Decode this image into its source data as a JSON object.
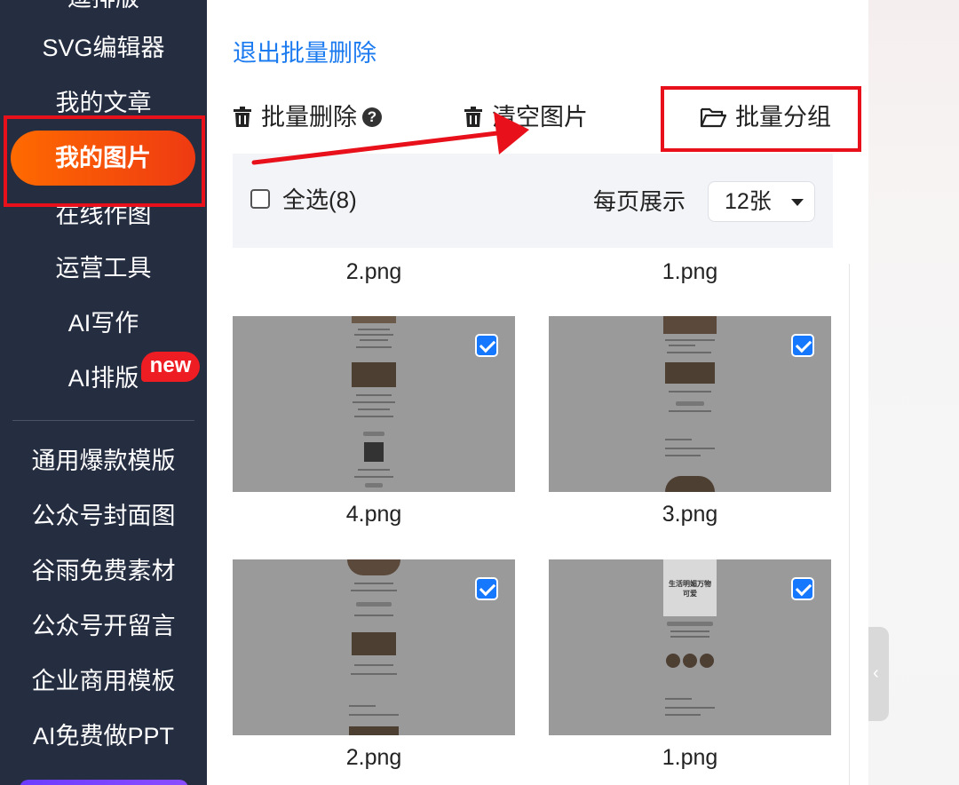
{
  "sidebar": {
    "top_partial": "逗排版",
    "items": [
      {
        "label": "SVG编辑器"
      },
      {
        "label": "我的文章"
      },
      {
        "label": "我的图片",
        "active": true
      },
      {
        "label": "在线作图"
      },
      {
        "label": "运营工具"
      },
      {
        "label": "AI写作"
      },
      {
        "label": "AI排版",
        "badge": "new"
      }
    ],
    "items2": [
      {
        "label": "通用爆款模版"
      },
      {
        "label": "公众号封面图"
      },
      {
        "label": "谷雨免费素材"
      },
      {
        "label": "公众号开留言"
      },
      {
        "label": "企业商用模板"
      },
      {
        "label": "AI免费做PPT"
      }
    ]
  },
  "main": {
    "exit_batch_delete": "退出批量删除",
    "toolbar": {
      "batch_delete": "批量删除",
      "help_glyph": "?",
      "clear_images": "清空图片",
      "batch_group": "批量分组"
    },
    "filter": {
      "select_all": "全选(8)",
      "per_page_label": "每页展示",
      "per_page_value": "12张"
    },
    "images": [
      {
        "name": "2.png",
        "checked": true
      },
      {
        "name": "1.png",
        "checked": true
      },
      {
        "name": "4.png",
        "checked": true
      },
      {
        "name": "3.png",
        "checked": true
      },
      {
        "name": "2.png",
        "checked": true
      },
      {
        "name": "1.png",
        "checked": true
      }
    ],
    "thumb_overlay_text": "生活明媚万物可爱"
  },
  "colors": {
    "sidebar_bg": "#252d41",
    "active_gradient_start": "#ff6a00",
    "active_gradient_end": "#ee3a12",
    "link_blue": "#1d7bf0",
    "checkbox_blue": "#1677ff",
    "annotation_red": "#e8101a"
  },
  "icons": {
    "trash": "trash-icon",
    "help": "question-circle-icon",
    "folder": "folder-open-icon",
    "dropdown": "caret-down-icon",
    "collapse": "chevron-left-icon"
  }
}
